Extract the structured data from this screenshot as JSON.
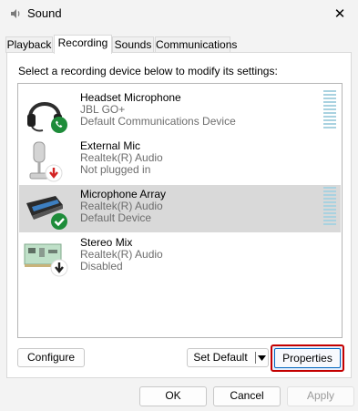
{
  "window": {
    "title": "Sound",
    "close_glyph": "✕"
  },
  "tabs": [
    {
      "label": "Playback"
    },
    {
      "label": "Recording"
    },
    {
      "label": "Sounds"
    },
    {
      "label": "Communications"
    }
  ],
  "active_tab": "Recording",
  "instructions": "Select a recording device below to modify its settings:",
  "devices": [
    {
      "name": "Headset Microphone",
      "line2": "JBL GO+",
      "line3": "Default Communications Device",
      "icon": "headset-icon",
      "badge": "phone-badge-icon",
      "selected": false,
      "meter": true
    },
    {
      "name": "External Mic",
      "line2": "Realtek(R) Audio",
      "line3": "Not plugged in",
      "icon": "microphone-icon",
      "badge": "unplugged-badge-icon",
      "selected": false,
      "meter": false
    },
    {
      "name": "Microphone Array",
      "line2": "Realtek(R) Audio",
      "line3": "Default Device",
      "icon": "microphone-array-icon",
      "badge": "default-check-badge-icon",
      "selected": true,
      "meter": true
    },
    {
      "name": "Stereo Mix",
      "line2": "Realtek(R) Audio",
      "line3": "Disabled",
      "icon": "circuit-board-icon",
      "badge": "disabled-badge-icon",
      "selected": false,
      "meter": false
    }
  ],
  "buttons": {
    "configure": "Configure",
    "set_default": "Set Default",
    "properties": "Properties",
    "ok": "OK",
    "cancel": "Cancel",
    "apply": "Apply"
  },
  "colors": {
    "highlight_border": "#c40000",
    "selection": "#d9d9d9",
    "meter": "#a9d2e0",
    "badge_green": "#1e8c3a",
    "badge_red": "#d32424"
  }
}
